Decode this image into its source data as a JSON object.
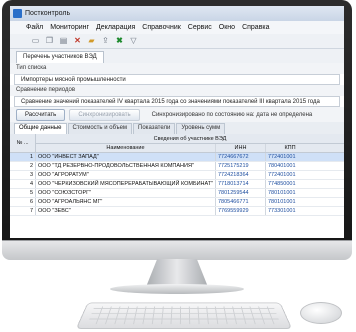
{
  "window": {
    "title": "Постконтроль"
  },
  "menu": [
    "Файл",
    "Мониторинг",
    "Декларация",
    "Справочник",
    "Сервис",
    "Окно",
    "Справка"
  ],
  "toolbar_icons": [
    "new-icon",
    "copy-icon",
    "paste-icon",
    "delete-icon",
    "folder-icon",
    "export-icon",
    "excel-icon",
    "filter-icon"
  ],
  "doc_tab": "Перечень участников ВЭД",
  "list_type": {
    "label": "Тип списка",
    "value": "Импортеры мясной промышленности"
  },
  "period": {
    "label": "Сравнение периодов",
    "value": "Сравнение значений показателей IV квартала 2015 года со значениями показателей III квартала 2015 года"
  },
  "buttons": {
    "calculate": "Рассчитать",
    "sync": "Синхронизировать",
    "sync_status": "Синхронизировано по состоянию на:  дата не определена"
  },
  "inner_tabs": [
    "Общие данные",
    "Стоимость и объем",
    "Показатели",
    "Уровень сумм"
  ],
  "grid": {
    "group_header": "Сведения об участнике ВЭД",
    "no_header": "№ ...",
    "col_name": "Наименование",
    "col_inn": "ИНН",
    "col_kpp": "КПП",
    "rows": [
      {
        "n": "1",
        "name": "ООО \"ИНВЕСТ ЗАПАД\"",
        "inn": "7724667672",
        "kpp": "772401001"
      },
      {
        "n": "2",
        "name": "ООО \"ТД РЕЗЕРВНО-ПРОДОВОЛЬСТВЕННАЯ КОМПАНИЯ\"",
        "inn": "7725175219",
        "kpp": "780401001"
      },
      {
        "n": "3",
        "name": "ООО \"АГРОРАТУМ\"",
        "inn": "7724218364",
        "kpp": "772401001"
      },
      {
        "n": "4",
        "name": "ООО \"ЧЕРКИЗОВСКИЙ МЯСОПЕРЕРАБАТЫВАЮЩИЙ КОМБИНАТ\"",
        "inn": "7718013714",
        "kpp": "774850001"
      },
      {
        "n": "5",
        "name": "ООО \"СОЮЗСТОРГ\"",
        "inn": "7801259544",
        "kpp": "780101001"
      },
      {
        "n": "6",
        "name": "ООО \"АГРОАЛЬЯНС МГ\"",
        "inn": "7805466771",
        "kpp": "780101001"
      },
      {
        "n": "7",
        "name": "ООО \"ЗЕВС\"",
        "inn": "7769559929",
        "kpp": "773301001"
      }
    ]
  }
}
